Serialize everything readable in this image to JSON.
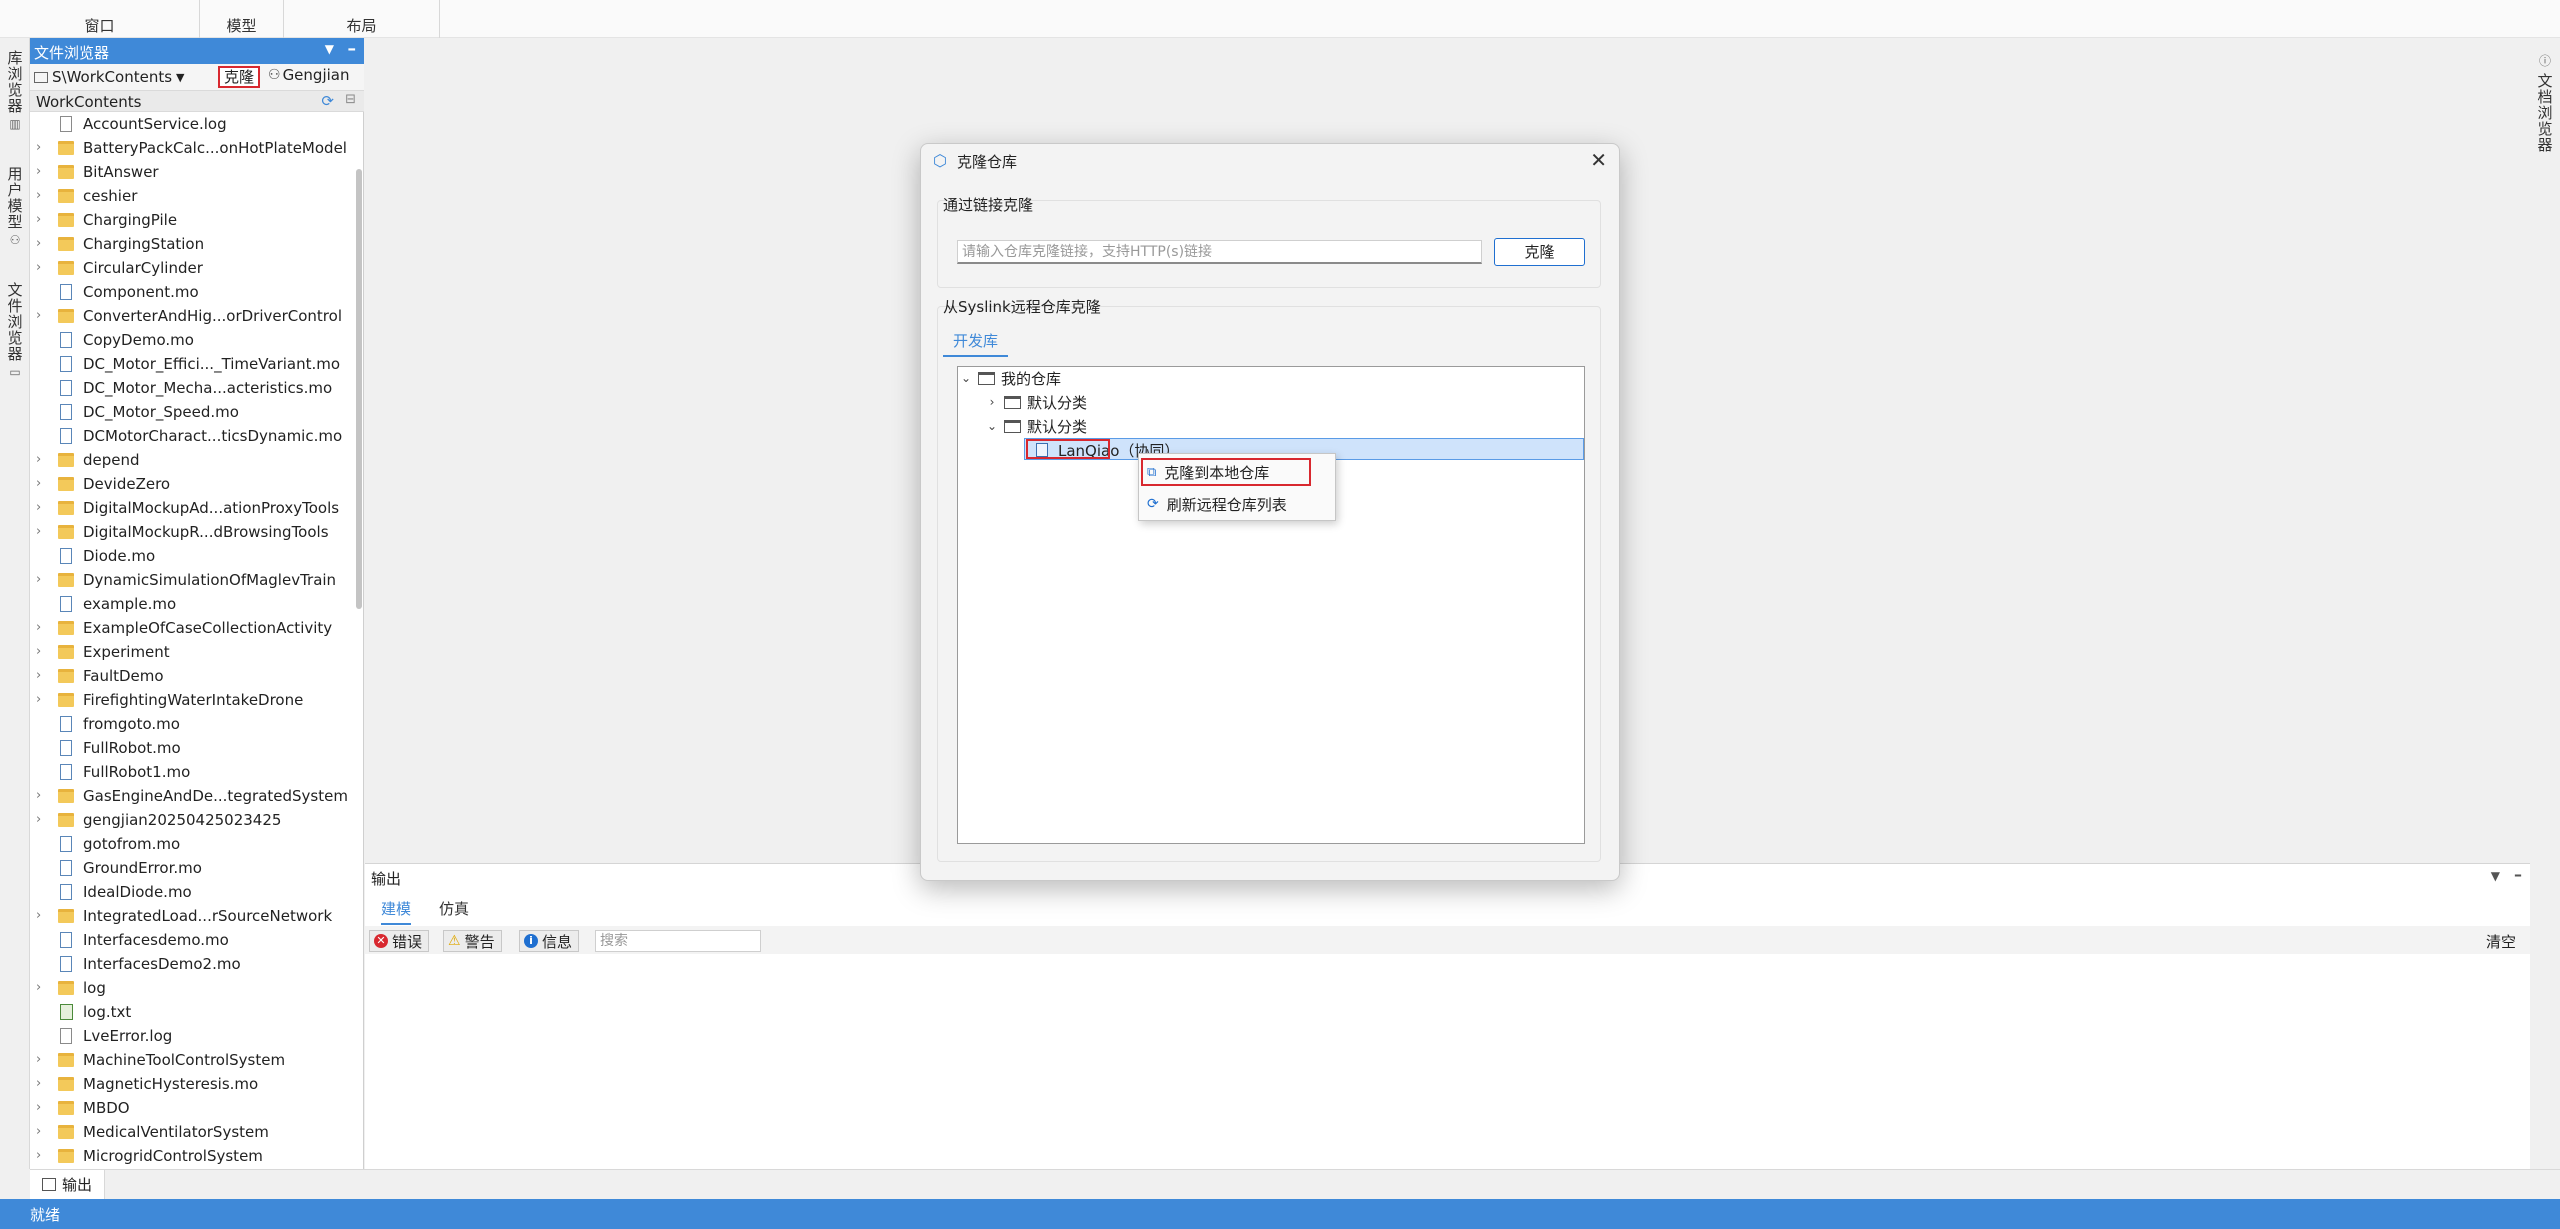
{
  "toolbar": {
    "groups": [
      {
        "label": "窗口"
      },
      {
        "label": "模型"
      },
      {
        "label": "布局"
      }
    ]
  },
  "left_strip": {
    "tabs": [
      "库浏览器",
      "用户模型",
      "文件浏览器"
    ]
  },
  "right_strip": {
    "tab": "文档浏览器"
  },
  "file_browser": {
    "title": "文件浏览器",
    "path": "S\\WorkContents",
    "clone_button": "克隆",
    "user": "Gengjian",
    "root": "WorkContents",
    "items": [
      {
        "name": "AccountService.log",
        "type": "file",
        "expandable": false
      },
      {
        "name": "BatteryPackCalc...onHotPlateModel",
        "type": "folder",
        "expandable": true
      },
      {
        "name": "BitAnswer",
        "type": "folder",
        "expandable": true
      },
      {
        "name": "ceshier",
        "type": "folder",
        "expandable": true
      },
      {
        "name": "ChargingPile",
        "type": "folder",
        "expandable": true
      },
      {
        "name": "ChargingStation",
        "type": "folder",
        "expandable": true
      },
      {
        "name": "CircularCylinder",
        "type": "folder",
        "expandable": true
      },
      {
        "name": "Component.mo",
        "type": "mo",
        "expandable": false
      },
      {
        "name": "ConverterAndHig...orDriverControl",
        "type": "folder",
        "expandable": true
      },
      {
        "name": "CopyDemo.mo",
        "type": "mo",
        "expandable": false
      },
      {
        "name": "DC_Motor_Effici..._TimeVariant.mo",
        "type": "mo",
        "expandable": false
      },
      {
        "name": "DC_Motor_Mecha...acteristics.mo",
        "type": "mo",
        "expandable": false
      },
      {
        "name": "DC_Motor_Speed.mo",
        "type": "mo",
        "expandable": false
      },
      {
        "name": "DCMotorCharact...ticsDynamic.mo",
        "type": "mo",
        "expandable": false
      },
      {
        "name": "depend",
        "type": "folder",
        "expandable": true
      },
      {
        "name": "DevideZero",
        "type": "folder",
        "expandable": true
      },
      {
        "name": "DigitalMockupAd...ationProxyTools",
        "type": "folder",
        "expandable": true
      },
      {
        "name": "DigitalMockupR...dBrowsingTools",
        "type": "folder",
        "expandable": true
      },
      {
        "name": "Diode.mo",
        "type": "mo",
        "expandable": false
      },
      {
        "name": "DynamicSimulationOfMaglevTrain",
        "type": "folder",
        "expandable": true
      },
      {
        "name": "example.mo",
        "type": "mo",
        "expandable": false
      },
      {
        "name": "ExampleOfCaseCollectionActivity",
        "type": "folder",
        "expandable": true
      },
      {
        "name": "Experiment",
        "type": "folder",
        "expandable": true
      },
      {
        "name": "FaultDemo",
        "type": "folder",
        "expandable": true
      },
      {
        "name": "FirefightingWaterIntakeDrone",
        "type": "folder",
        "expandable": true
      },
      {
        "name": "fromgoto.mo",
        "type": "mo",
        "expandable": false
      },
      {
        "name": "FullRobot.mo",
        "type": "mo",
        "expandable": false
      },
      {
        "name": "FullRobot1.mo",
        "type": "mo",
        "expandable": false
      },
      {
        "name": "GasEngineAndDe...tegratedSystem",
        "type": "folder",
        "expandable": true
      },
      {
        "name": "gengjian20250425023425",
        "type": "folder",
        "expandable": true
      },
      {
        "name": "gotofrom.mo",
        "type": "mo",
        "expandable": false
      },
      {
        "name": "GroundError.mo",
        "type": "mo",
        "expandable": false
      },
      {
        "name": "IdealDiode.mo",
        "type": "mo",
        "expandable": false
      },
      {
        "name": "IntegratedLoad...rSourceNetwork",
        "type": "folder",
        "expandable": true
      },
      {
        "name": "Interfacesdemo.mo",
        "type": "mo",
        "expandable": false
      },
      {
        "name": "InterfacesDemo2.mo",
        "type": "mo",
        "expandable": false
      },
      {
        "name": "log",
        "type": "folder",
        "expandable": true
      },
      {
        "name": "log.txt",
        "type": "txt",
        "expandable": false
      },
      {
        "name": "LveError.log",
        "type": "file",
        "expandable": false
      },
      {
        "name": "MachineToolControlSystem",
        "type": "folder",
        "expandable": true
      },
      {
        "name": "MagneticHysteresis.mo",
        "type": "folder",
        "expandable": true
      },
      {
        "name": "MBDO",
        "type": "folder",
        "expandable": true
      },
      {
        "name": "MedicalVentilatorSystem",
        "type": "folder",
        "expandable": true
      },
      {
        "name": "MicrogridControlSystem",
        "type": "folder",
        "expandable": true
      }
    ]
  },
  "output": {
    "title": "输出",
    "tabs": [
      "建模",
      "仿真"
    ],
    "filters": {
      "error": "错误",
      "warning": "警告",
      "info": "信息"
    },
    "search_placeholder": "搜索",
    "clear": "清空"
  },
  "bottom_tab": {
    "label": "输出"
  },
  "status": {
    "text": "就绪"
  },
  "dialog": {
    "title": "克隆仓库",
    "link_section_title": "通过链接克隆",
    "url_placeholder": "请输入仓库克隆链接，支持HTTP(s)链接",
    "clone_button": "克隆",
    "remote_section_title": "从Syslink远程仓库克隆",
    "tab": "开发库",
    "tree": {
      "root": "我的仓库",
      "categories": [
        "默认分类",
        "默认分类"
      ],
      "selected_repo": "LanQiao（协同）"
    }
  },
  "context_menu": {
    "items": [
      "克隆到本地仓库",
      "刷新远程仓库列表"
    ]
  },
  "colors": {
    "accent": "#3f89d8",
    "highlight_red": "#d8282f",
    "error": "#d8282f",
    "warning": "#e0a800",
    "info": "#1f6fd0"
  }
}
